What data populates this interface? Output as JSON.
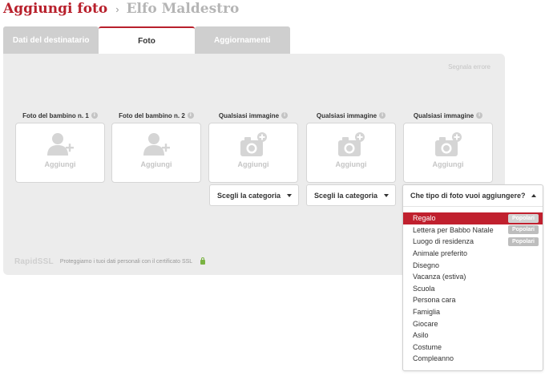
{
  "header": {
    "title": "Aggiungi foto",
    "separator": "›",
    "subtitle": "Elfo Maldestro"
  },
  "tabs": [
    {
      "label": "Dati del destinatario",
      "active": false
    },
    {
      "label": "Foto",
      "active": true
    },
    {
      "label": "Aggiornamenti",
      "active": false
    }
  ],
  "panel": {
    "report_link": "Segnala errore"
  },
  "slots": [
    {
      "label": "Foto del bambino n. 1",
      "icon": "user-add-icon",
      "add_label": "Aggiungi"
    },
    {
      "label": "Foto del bambino n. 2",
      "icon": "user-add-icon",
      "add_label": "Aggiungi"
    },
    {
      "label": "Qualsiasi immagine",
      "icon": "camera-add-icon",
      "add_label": "Aggiungi"
    },
    {
      "label": "Qualsiasi immagine",
      "icon": "camera-add-icon",
      "add_label": "Aggiungi"
    },
    {
      "label": "Qualsiasi immagine",
      "icon": "camera-add-icon",
      "add_label": "Aggiungi"
    }
  ],
  "category_selects": [
    {
      "value": "Scegli la categoria"
    },
    {
      "value": "Scegli la categoria"
    }
  ],
  "info_icon": "i",
  "ssl": {
    "logo": "RapidSSL",
    "text": "Proteggiamo i tuoi dati personali con il certificato SSL"
  },
  "dropdown": {
    "header": "Che tipo di foto vuoi aggiungere?",
    "items": [
      {
        "label": "Regalo",
        "badge": "Popolari",
        "selected": true
      },
      {
        "label": "Lettera per Babbo Natale",
        "badge": "Popolari",
        "selected": false
      },
      {
        "label": "Luogo di residenza",
        "badge": "Popolari",
        "selected": false
      },
      {
        "label": "Animale preferito",
        "badge": "",
        "selected": false
      },
      {
        "label": "Disegno",
        "badge": "",
        "selected": false
      },
      {
        "label": "Vacanza (estiva)",
        "badge": "",
        "selected": false
      },
      {
        "label": "Scuola",
        "badge": "",
        "selected": false
      },
      {
        "label": "Persona cara",
        "badge": "",
        "selected": false
      },
      {
        "label": "Famiglia",
        "badge": "",
        "selected": false
      },
      {
        "label": "Giocare",
        "badge": "",
        "selected": false
      },
      {
        "label": "Asilo",
        "badge": "",
        "selected": false
      },
      {
        "label": "Costume",
        "badge": "",
        "selected": false
      },
      {
        "label": "Compleanno",
        "badge": "",
        "selected": false
      }
    ]
  },
  "colors": {
    "brand_red": "#b8202c",
    "selected_red": "#c0202e",
    "panel_gray": "#ececec",
    "tab_gray": "#cfcfcf"
  }
}
